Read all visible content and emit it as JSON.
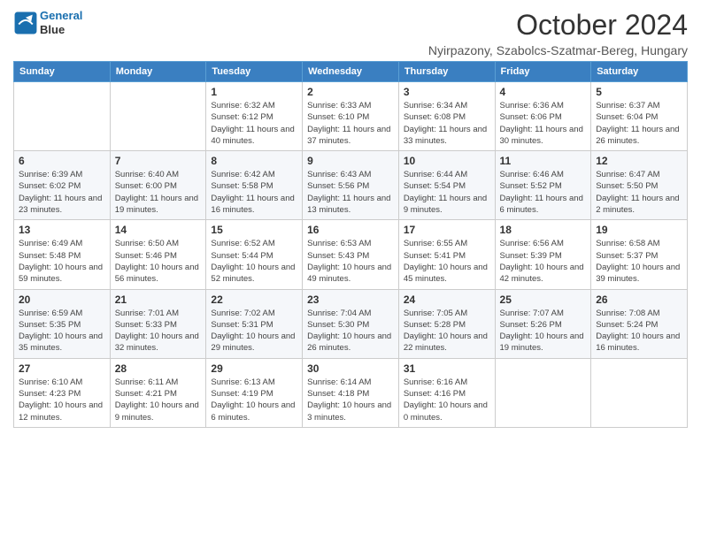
{
  "header": {
    "logo_line1": "General",
    "logo_line2": "Blue",
    "month_title": "October 2024",
    "location": "Nyirpazony, Szabolcs-Szatmar-Bereg, Hungary"
  },
  "days_of_week": [
    "Sunday",
    "Monday",
    "Tuesday",
    "Wednesday",
    "Thursday",
    "Friday",
    "Saturday"
  ],
  "weeks": [
    [
      {
        "day": "",
        "info": ""
      },
      {
        "day": "",
        "info": ""
      },
      {
        "day": "1",
        "info": "Sunrise: 6:32 AM\nSunset: 6:12 PM\nDaylight: 11 hours and 40 minutes."
      },
      {
        "day": "2",
        "info": "Sunrise: 6:33 AM\nSunset: 6:10 PM\nDaylight: 11 hours and 37 minutes."
      },
      {
        "day": "3",
        "info": "Sunrise: 6:34 AM\nSunset: 6:08 PM\nDaylight: 11 hours and 33 minutes."
      },
      {
        "day": "4",
        "info": "Sunrise: 6:36 AM\nSunset: 6:06 PM\nDaylight: 11 hours and 30 minutes."
      },
      {
        "day": "5",
        "info": "Sunrise: 6:37 AM\nSunset: 6:04 PM\nDaylight: 11 hours and 26 minutes."
      }
    ],
    [
      {
        "day": "6",
        "info": "Sunrise: 6:39 AM\nSunset: 6:02 PM\nDaylight: 11 hours and 23 minutes."
      },
      {
        "day": "7",
        "info": "Sunrise: 6:40 AM\nSunset: 6:00 PM\nDaylight: 11 hours and 19 minutes."
      },
      {
        "day": "8",
        "info": "Sunrise: 6:42 AM\nSunset: 5:58 PM\nDaylight: 11 hours and 16 minutes."
      },
      {
        "day": "9",
        "info": "Sunrise: 6:43 AM\nSunset: 5:56 PM\nDaylight: 11 hours and 13 minutes."
      },
      {
        "day": "10",
        "info": "Sunrise: 6:44 AM\nSunset: 5:54 PM\nDaylight: 11 hours and 9 minutes."
      },
      {
        "day": "11",
        "info": "Sunrise: 6:46 AM\nSunset: 5:52 PM\nDaylight: 11 hours and 6 minutes."
      },
      {
        "day": "12",
        "info": "Sunrise: 6:47 AM\nSunset: 5:50 PM\nDaylight: 11 hours and 2 minutes."
      }
    ],
    [
      {
        "day": "13",
        "info": "Sunrise: 6:49 AM\nSunset: 5:48 PM\nDaylight: 10 hours and 59 minutes."
      },
      {
        "day": "14",
        "info": "Sunrise: 6:50 AM\nSunset: 5:46 PM\nDaylight: 10 hours and 56 minutes."
      },
      {
        "day": "15",
        "info": "Sunrise: 6:52 AM\nSunset: 5:44 PM\nDaylight: 10 hours and 52 minutes."
      },
      {
        "day": "16",
        "info": "Sunrise: 6:53 AM\nSunset: 5:43 PM\nDaylight: 10 hours and 49 minutes."
      },
      {
        "day": "17",
        "info": "Sunrise: 6:55 AM\nSunset: 5:41 PM\nDaylight: 10 hours and 45 minutes."
      },
      {
        "day": "18",
        "info": "Sunrise: 6:56 AM\nSunset: 5:39 PM\nDaylight: 10 hours and 42 minutes."
      },
      {
        "day": "19",
        "info": "Sunrise: 6:58 AM\nSunset: 5:37 PM\nDaylight: 10 hours and 39 minutes."
      }
    ],
    [
      {
        "day": "20",
        "info": "Sunrise: 6:59 AM\nSunset: 5:35 PM\nDaylight: 10 hours and 35 minutes."
      },
      {
        "day": "21",
        "info": "Sunrise: 7:01 AM\nSunset: 5:33 PM\nDaylight: 10 hours and 32 minutes."
      },
      {
        "day": "22",
        "info": "Sunrise: 7:02 AM\nSunset: 5:31 PM\nDaylight: 10 hours and 29 minutes."
      },
      {
        "day": "23",
        "info": "Sunrise: 7:04 AM\nSunset: 5:30 PM\nDaylight: 10 hours and 26 minutes."
      },
      {
        "day": "24",
        "info": "Sunrise: 7:05 AM\nSunset: 5:28 PM\nDaylight: 10 hours and 22 minutes."
      },
      {
        "day": "25",
        "info": "Sunrise: 7:07 AM\nSunset: 5:26 PM\nDaylight: 10 hours and 19 minutes."
      },
      {
        "day": "26",
        "info": "Sunrise: 7:08 AM\nSunset: 5:24 PM\nDaylight: 10 hours and 16 minutes."
      }
    ],
    [
      {
        "day": "27",
        "info": "Sunrise: 6:10 AM\nSunset: 4:23 PM\nDaylight: 10 hours and 12 minutes."
      },
      {
        "day": "28",
        "info": "Sunrise: 6:11 AM\nSunset: 4:21 PM\nDaylight: 10 hours and 9 minutes."
      },
      {
        "day": "29",
        "info": "Sunrise: 6:13 AM\nSunset: 4:19 PM\nDaylight: 10 hours and 6 minutes."
      },
      {
        "day": "30",
        "info": "Sunrise: 6:14 AM\nSunset: 4:18 PM\nDaylight: 10 hours and 3 minutes."
      },
      {
        "day": "31",
        "info": "Sunrise: 6:16 AM\nSunset: 4:16 PM\nDaylight: 10 hours and 0 minutes."
      },
      {
        "day": "",
        "info": ""
      },
      {
        "day": "",
        "info": ""
      }
    ]
  ]
}
